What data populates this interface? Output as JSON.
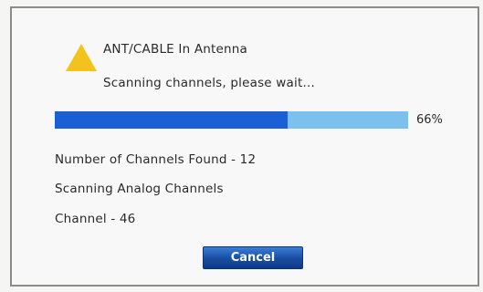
{
  "dialog": {
    "source": "ANT/CABLE In  Antenna",
    "status": "Scanning channels, please wait...",
    "progress": {
      "fraction": 0.66,
      "label": "66%"
    },
    "channels_found": "Number of Channels Found -  12",
    "scan_mode": "Scanning Analog Channels",
    "current_channel": "Channel -  46",
    "cancel_label": "Cancel"
  },
  "colors": {
    "warning_icon": "#f3c21c",
    "progress_fill": "#1a5fd4",
    "progress_track": "#7cc0ee",
    "button": "#1a4fa3"
  },
  "icons": {
    "warning": "warning-triangle-icon"
  }
}
